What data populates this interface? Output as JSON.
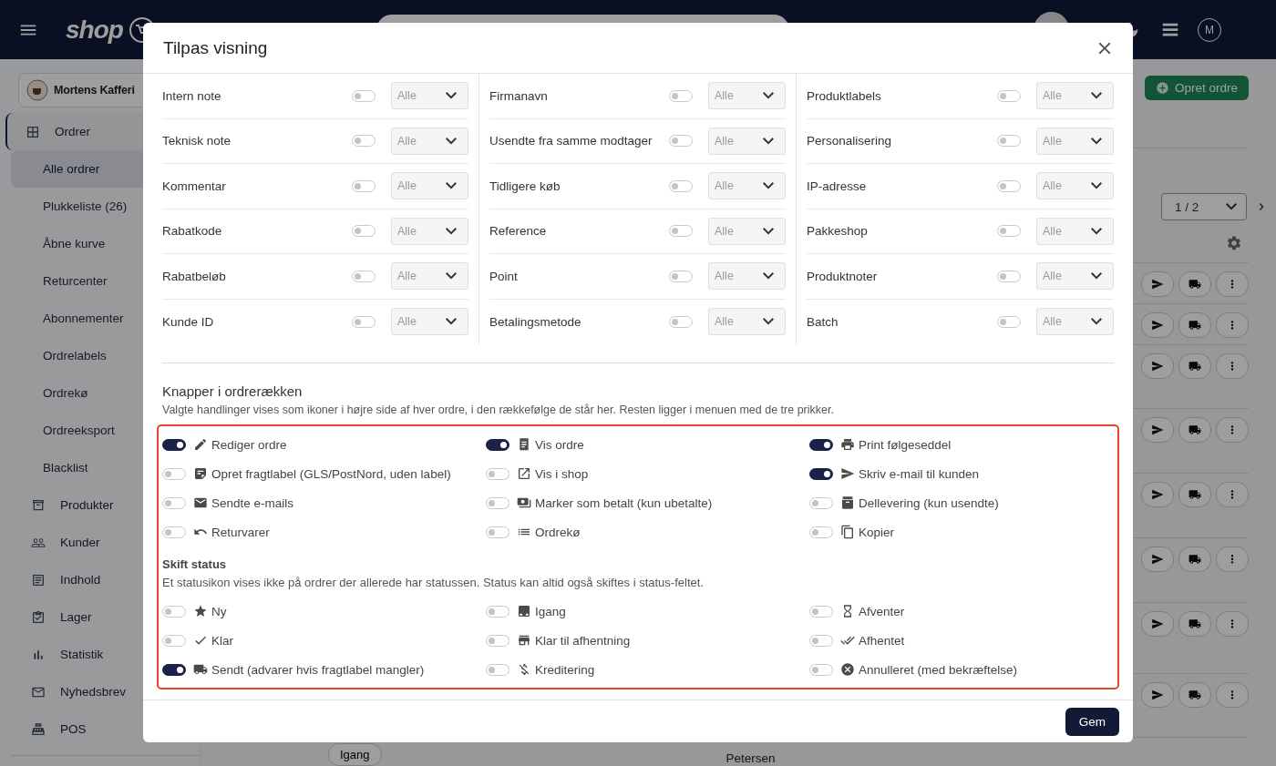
{
  "top_bar": {
    "logo": "shop",
    "user_initial": "M"
  },
  "sidebar": {
    "store": "Mortens Kafferi",
    "items": [
      {
        "label": "Ordrer",
        "selected": true,
        "children": [
          {
            "label": "Alle ordrer",
            "selected": true
          },
          {
            "label": "Plukkeliste (26)",
            "selected": false
          },
          {
            "label": "Åbne kurve",
            "selected": false
          },
          {
            "label": "Returcenter",
            "selected": false
          },
          {
            "label": "Abonnementer",
            "selected": false
          },
          {
            "label": "Ordrelabels",
            "selected": false
          },
          {
            "label": "Ordrekø",
            "selected": false
          },
          {
            "label": "Ordreeksport",
            "selected": false
          },
          {
            "label": "Blacklist",
            "selected": false
          }
        ]
      },
      {
        "label": "Produkter",
        "selected": false
      },
      {
        "label": "Kunder",
        "selected": false
      },
      {
        "label": "Indhold",
        "selected": false
      },
      {
        "label": "Lager",
        "selected": false
      },
      {
        "label": "Statistik",
        "selected": false
      },
      {
        "label": "Nyhedsbrev",
        "selected": false
      },
      {
        "label": "POS",
        "selected": false
      }
    ]
  },
  "orders": {
    "create_button": "Opret ordre",
    "pager": "1 / 2",
    "last_row": {
      "status": "Igang",
      "customer": "Petersen"
    }
  },
  "dialog": {
    "title": "Tilpas visning",
    "field_columns": [
      [
        {
          "label": "Intern note",
          "on": false,
          "filter": "Alle"
        },
        {
          "label": "Teknisk note",
          "on": false,
          "filter": "Alle"
        },
        {
          "label": "Kommentar",
          "on": false,
          "filter": "Alle"
        },
        {
          "label": "Rabatkode",
          "on": false,
          "filter": "Alle"
        },
        {
          "label": "Rabatbeløb",
          "on": false,
          "filter": "Alle"
        },
        {
          "label": "Kunde ID",
          "on": false,
          "filter": "Alle"
        }
      ],
      [
        {
          "label": "Firmanavn",
          "on": false,
          "filter": "Alle"
        },
        {
          "label": "Usendte fra samme modtager",
          "on": false,
          "filter": "Alle"
        },
        {
          "label": "Tidligere køb",
          "on": false,
          "filter": "Alle"
        },
        {
          "label": "Reference",
          "on": false,
          "filter": "Alle"
        },
        {
          "label": "Point",
          "on": false,
          "filter": "Alle"
        },
        {
          "label": "Betalingsmetode",
          "on": false,
          "filter": "Alle"
        }
      ],
      [
        {
          "label": "Produktlabels",
          "on": false,
          "filter": "Alle"
        },
        {
          "label": "Personalisering",
          "on": false,
          "filter": "Alle"
        },
        {
          "label": "IP-adresse",
          "on": false,
          "filter": "Alle"
        },
        {
          "label": "Pakkeshop",
          "on": false,
          "filter": "Alle"
        },
        {
          "label": "Produktnoter",
          "on": false,
          "filter": "Alle"
        },
        {
          "label": "Batch",
          "on": false,
          "filter": "Alle"
        }
      ]
    ],
    "buttons_title": "Knapper i ordrerækken",
    "buttons_description": "Valgte handlinger vises som ikoner i højre side af hver ordre, i den rækkefølge de står her. Resten ligger i menuen med de tre prikker.",
    "actions": [
      {
        "label": "Rediger ordre",
        "on": true
      },
      {
        "label": "Vis ordre",
        "on": true
      },
      {
        "label": "Print følgeseddel",
        "on": true
      },
      {
        "label": "Opret fragtlabel (GLS/PostNord, uden label)",
        "on": false
      },
      {
        "label": "Vis i shop",
        "on": false
      },
      {
        "label": "Skriv e-mail til kunden",
        "on": true
      },
      {
        "label": "Sendte e-mails",
        "on": false
      },
      {
        "label": "Marker som betalt (kun ubetalte)",
        "on": false
      },
      {
        "label": "Dellevering (kun usendte)",
        "on": false
      },
      {
        "label": "Returvarer",
        "on": false
      },
      {
        "label": "Ordrekø",
        "on": false
      },
      {
        "label": "Kopier",
        "on": false
      }
    ],
    "status_title": "Skift status",
    "status_description": "Et statusikon vises ikke på ordrer der allerede har statussen. Status kan altid også skiftes i status-feltet.",
    "statuses": [
      {
        "label": "Ny",
        "on": false
      },
      {
        "label": "Igang",
        "on": false
      },
      {
        "label": "Afventer",
        "on": false
      },
      {
        "label": "Klar",
        "on": false
      },
      {
        "label": "Klar til afhentning",
        "on": false
      },
      {
        "label": "Afhentet",
        "on": false
      },
      {
        "label": "Sendt (advarer hvis fragtlabel mangler)",
        "on": true
      },
      {
        "label": "Kreditering",
        "on": false
      },
      {
        "label": "Annulleret (med bekræftelse)",
        "on": false
      }
    ],
    "save_button": "Gem"
  }
}
